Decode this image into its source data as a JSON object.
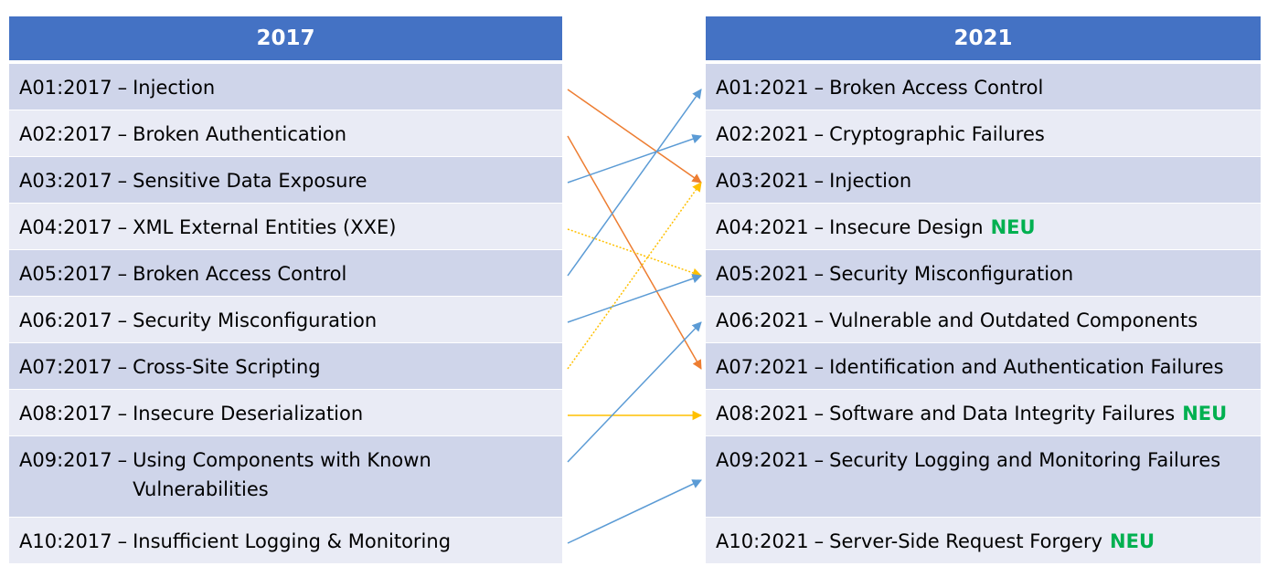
{
  "left": {
    "header": "2017",
    "items": [
      {
        "code": "A01:2017",
        "name": "Injection"
      },
      {
        "code": "A02:2017",
        "name": "Broken Authentication"
      },
      {
        "code": "A03:2017",
        "name": "Sensitive Data Exposure"
      },
      {
        "code": "A04:2017",
        "name": "XML External Entities (XXE)"
      },
      {
        "code": "A05:2017",
        "name": "Broken Access Control"
      },
      {
        "code": "A06:2017",
        "name": "Security Misconfiguration"
      },
      {
        "code": "A07:2017",
        "name": "Cross-Site Scripting"
      },
      {
        "code": "A08:2017",
        "name": "Insecure Deserialization"
      },
      {
        "code": "A09:2017",
        "name": "Using Components with Known",
        "name2": "Vulnerabilities"
      },
      {
        "code": "A10:2017",
        "name": "Insufficient Logging & Monitoring"
      }
    ]
  },
  "right": {
    "header": "2021",
    "items": [
      {
        "code": "A01:2021",
        "name": "Broken Access Control"
      },
      {
        "code": "A02:2021",
        "name": "Cryptographic Failures"
      },
      {
        "code": "A03:2021",
        "name": "Injection"
      },
      {
        "code": "A04:2021",
        "name": "Insecure Design",
        "badge": "NEU"
      },
      {
        "code": "A05:2021",
        "name": "Security Misconfiguration"
      },
      {
        "code": "A06:2021",
        "name": "Vulnerable and Outdated Components"
      },
      {
        "code": "A07:2021",
        "name": "Identification and Authentication Failures"
      },
      {
        "code": "A08:2021",
        "name": "Software and Data Integrity Failures",
        "badge": "NEU"
      },
      {
        "code": "A09:2021",
        "name": "Security Logging and Monitoring Failures"
      },
      {
        "code": "A10:2021",
        "name": "Server-Side Request Forgery",
        "badge": "NEU"
      }
    ]
  },
  "dash": "–",
  "mappings": [
    {
      "from": 1,
      "to": 3,
      "color": "#ED7D31",
      "style": "solid"
    },
    {
      "from": 2,
      "to": 7,
      "color": "#ED7D31",
      "style": "solid"
    },
    {
      "from": 3,
      "to": 2,
      "color": "#5B9BD5",
      "style": "solid"
    },
    {
      "from": 4,
      "to": 5,
      "color": "#FFC000",
      "style": "dotted"
    },
    {
      "from": 5,
      "to": 1,
      "color": "#5B9BD5",
      "style": "solid"
    },
    {
      "from": 6,
      "to": 5,
      "color": "#5B9BD5",
      "style": "solid"
    },
    {
      "from": 7,
      "to": 3,
      "color": "#FFC000",
      "style": "dotted"
    },
    {
      "from": 8,
      "to": 8,
      "color": "#FFC000",
      "style": "solid"
    },
    {
      "from": 9,
      "to": 6,
      "color": "#5B9BD5",
      "style": "solid"
    },
    {
      "from": 10,
      "to": 9,
      "color": "#5B9BD5",
      "style": "solid"
    }
  ],
  "colors": {
    "header_bg": "#4472C4",
    "row_odd": "#CFD5EA",
    "row_even": "#E9EBF5",
    "new_badge": "#00B050"
  }
}
